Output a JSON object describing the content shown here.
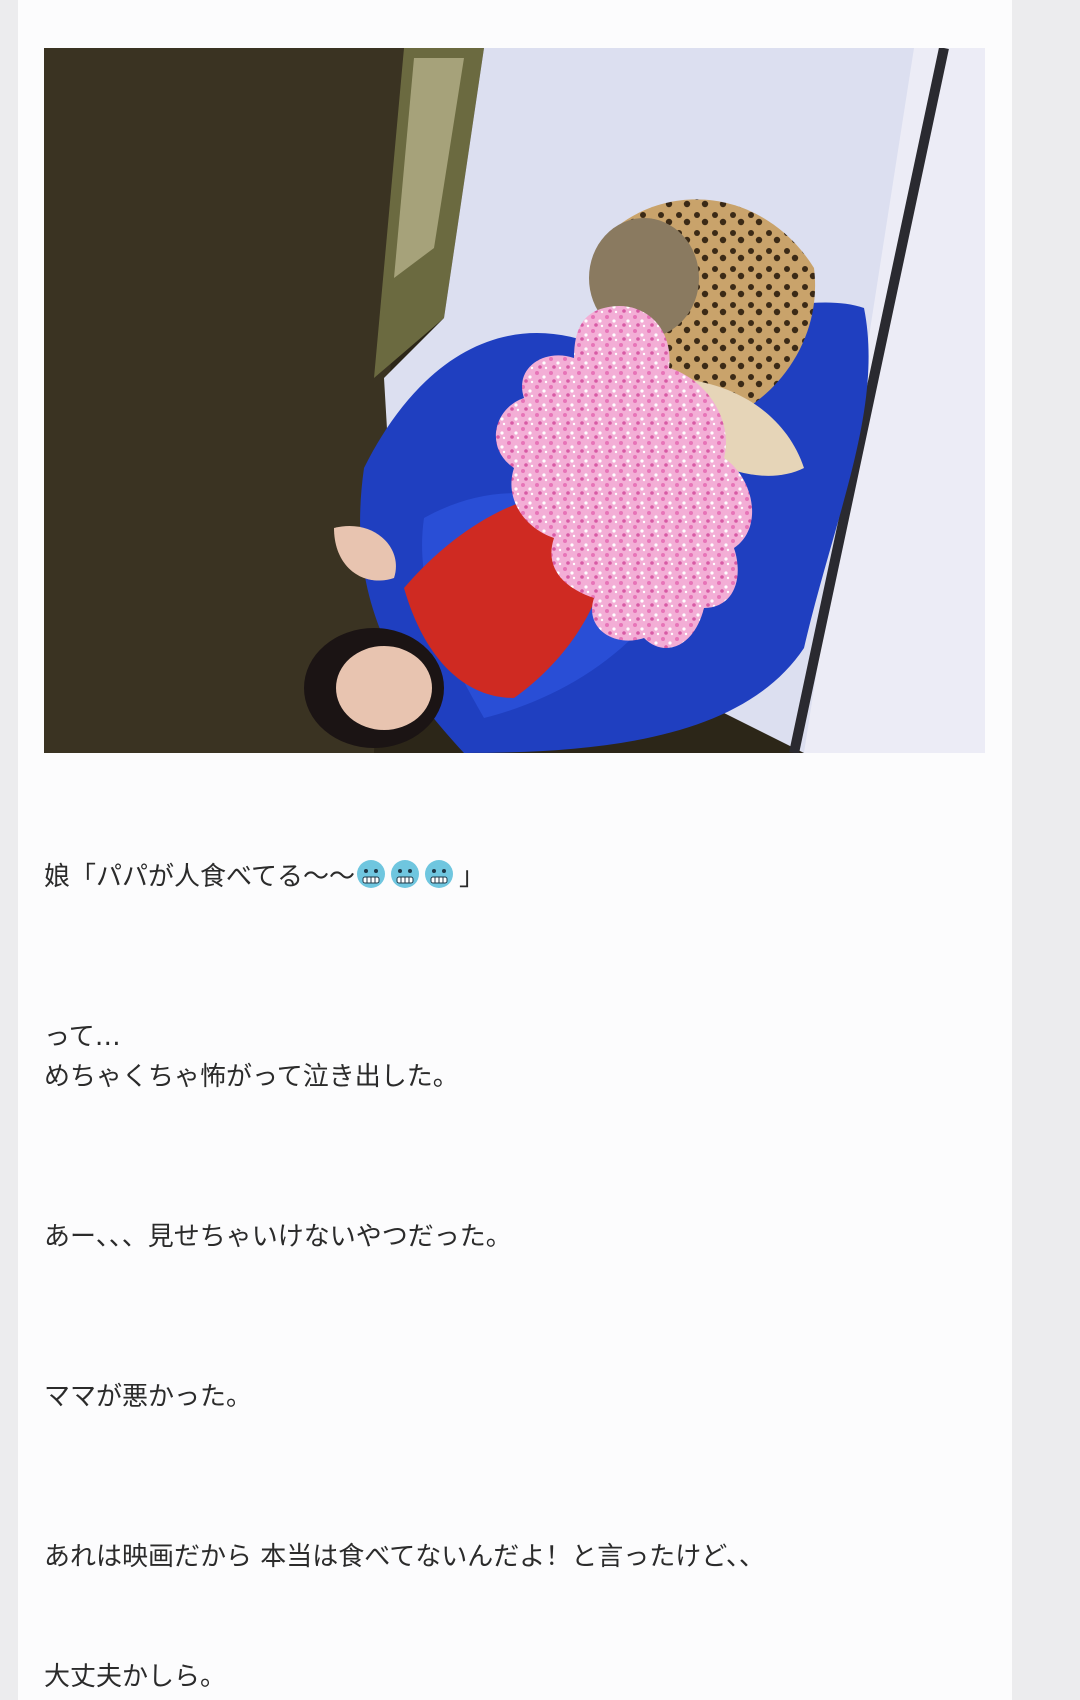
{
  "post": {
    "image_alt": "",
    "paragraphs": [
      {
        "prefix": "娘「パパが人食べてる〜〜",
        "emojis": [
          "cold-face",
          "cold-face",
          "cold-face"
        ],
        "suffix": "」"
      },
      {
        "line1": "って…",
        "line2": "めちゃくちゃ怖がって泣き出した。"
      },
      {
        "text": "あー、、、見せちゃいけないやつだった。"
      },
      {
        "text": "ママが悪かった。"
      },
      {
        "text": "あれは映画だから  本当は食べてないんだよ！と言ったけど、、"
      },
      {
        "text": "大丈夫かしら。"
      }
    ]
  },
  "colors": {
    "page_bg": "#ececee",
    "content_bg": "#fcfcfd",
    "text": "#2b2b2b",
    "emoji": "#6fc6df",
    "censor_blob": "#f2a6d3"
  }
}
